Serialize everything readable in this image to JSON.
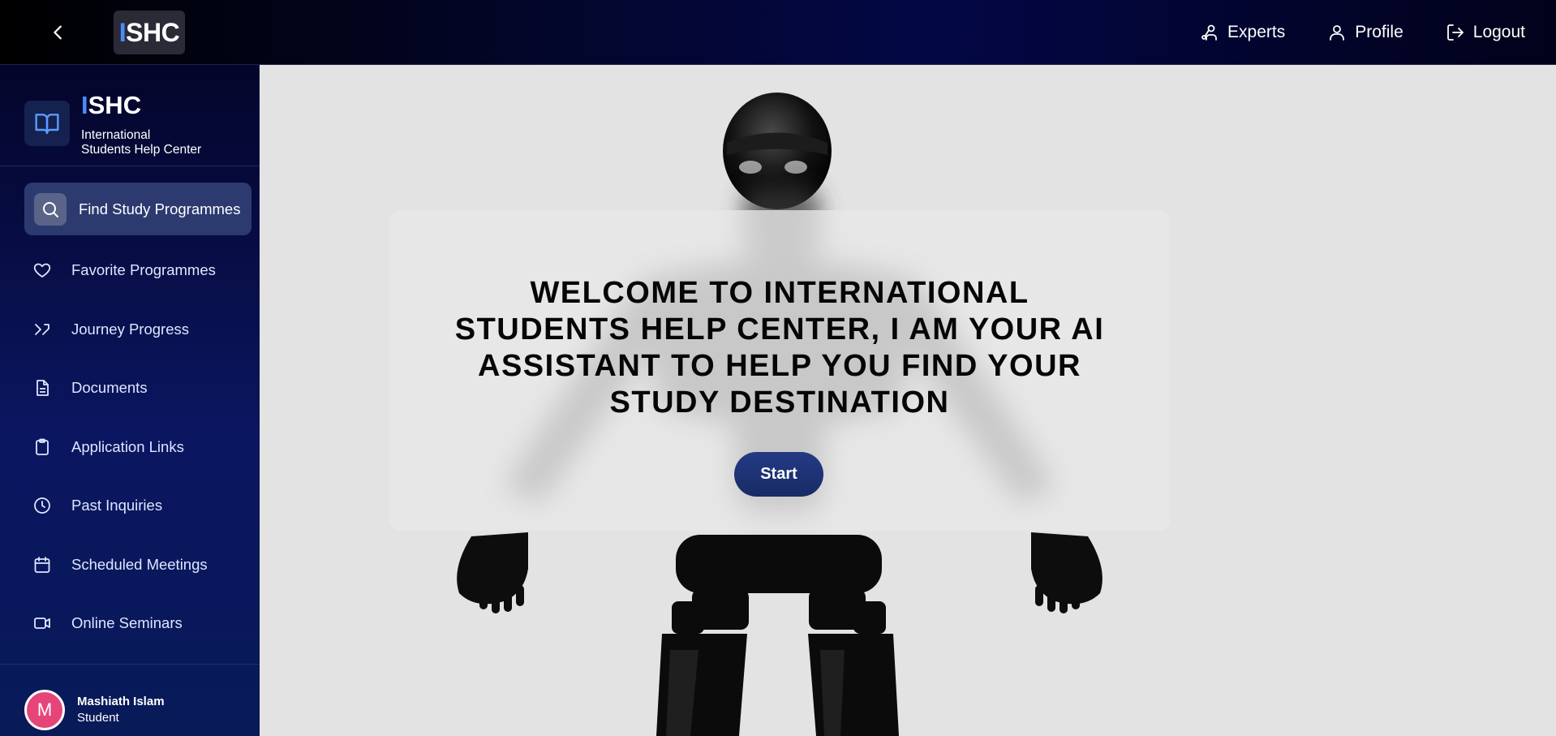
{
  "header": {
    "logo_accent": "I",
    "logo_rest": "SHC",
    "nav": [
      {
        "label": "Experts",
        "icon": "experts-icon"
      },
      {
        "label": "Profile",
        "icon": "user-icon"
      },
      {
        "label": "Logout",
        "icon": "logout-icon"
      }
    ]
  },
  "sidebar": {
    "brand_accent": "I",
    "brand_rest": "SHC",
    "brand_line1": "International",
    "brand_line2": "Students Help Center",
    "items": [
      {
        "label": "Find Study Programmes",
        "icon": "search-icon",
        "active": true
      },
      {
        "label": "Favorite Programmes",
        "icon": "heart-icon"
      },
      {
        "label": "Journey Progress",
        "icon": "route-icon"
      },
      {
        "label": "Documents",
        "icon": "document-icon"
      },
      {
        "label": "Application Links",
        "icon": "clipboard-icon"
      },
      {
        "label": "Past Inquiries",
        "icon": "clock-icon"
      },
      {
        "label": "Scheduled Meetings",
        "icon": "calendar-icon"
      },
      {
        "label": "Online Seminars",
        "icon": "video-icon"
      }
    ],
    "user": {
      "initial": "M",
      "name": "Mashiath Islam",
      "role": "Student"
    }
  },
  "main": {
    "welcome_title": "WELCOME TO INTERNATIONAL STUDENTS HELP CENTER, I AM YOUR AI ASSISTANT TO HELP YOU FIND YOUR STUDY DESTINATION",
    "start_label": "Start"
  },
  "colors": {
    "accent": "#4a8bff",
    "sidebar_bg": "#0a1660",
    "avatar": "#e6457a",
    "start_button": "#1f3478"
  }
}
